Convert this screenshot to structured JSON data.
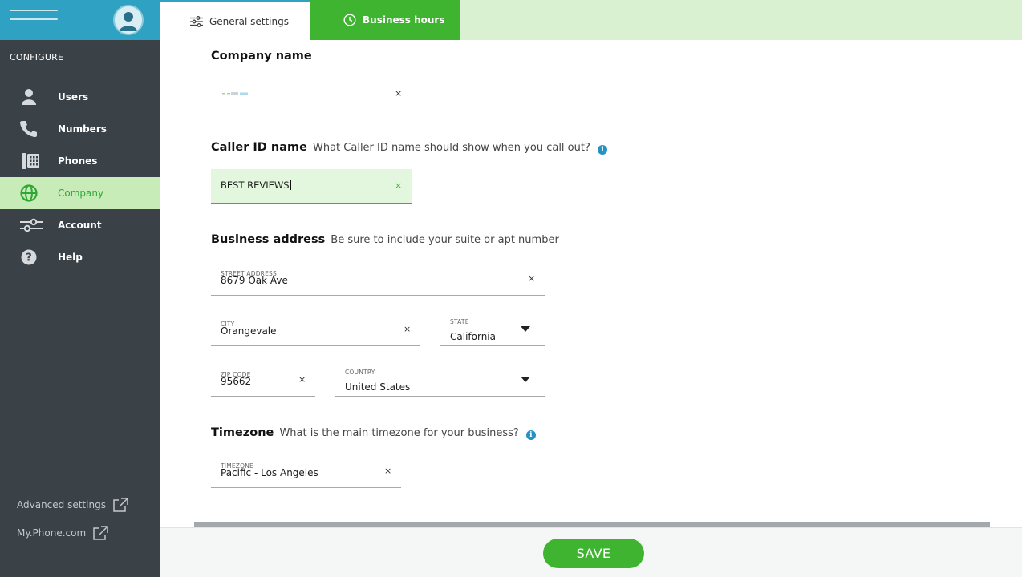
{
  "sidebar": {
    "section_label": "CONFIGURE",
    "items": [
      {
        "label": "Users",
        "icon": "user-icon",
        "active": false
      },
      {
        "label": "Numbers",
        "icon": "phone-handset-icon",
        "active": false
      },
      {
        "label": "Phones",
        "icon": "desk-phone-icon",
        "active": false
      },
      {
        "label": "Company",
        "icon": "globe-icon",
        "active": true
      },
      {
        "label": "Account",
        "icon": "sliders-icon",
        "active": false
      },
      {
        "label": "Help",
        "icon": "help-icon",
        "active": false
      }
    ],
    "links": [
      {
        "label": "Advanced settings",
        "icon": "external-link-icon"
      },
      {
        "label": "My.Phone.com",
        "icon": "external-link-icon"
      }
    ]
  },
  "tabs": [
    {
      "label": "General settings",
      "icon": "settings-sliders-icon",
      "active": true
    },
    {
      "label": "Business hours",
      "icon": "clock-icon",
      "active": false
    }
  ],
  "company": {
    "title": "Company name"
  },
  "caller_id": {
    "title": "Caller ID name",
    "hint": "What Caller ID name should show when you call out?",
    "value": "BEST REVIEWS"
  },
  "address": {
    "title": "Business address",
    "hint": "Be sure to include your suite or apt number",
    "street_label": "STREET ADDRESS",
    "street": "8679 Oak Ave",
    "city_label": "CITY",
    "city": "Orangevale",
    "state_label": "STATE",
    "state": "California",
    "zip_label": "ZIP CODE",
    "zip": "95662",
    "country_label": "COUNTRY",
    "country": "United States"
  },
  "timezone": {
    "title": "Timezone",
    "hint": "What is the main timezone for your business?",
    "label": "TIMEZONE",
    "value": "Pacific - Los Angeles"
  },
  "footer": {
    "save_label": "SAVE"
  },
  "colors": {
    "sidebar_bg": "#3a4147",
    "brand_bg": "#2fa1c2",
    "accent_green": "#3fb431",
    "active_nav_bg": "#c8ecb8",
    "tabbar_bg": "#d9f1d1",
    "info_blue": "#2592c4"
  },
  "clear_symbol": "×"
}
